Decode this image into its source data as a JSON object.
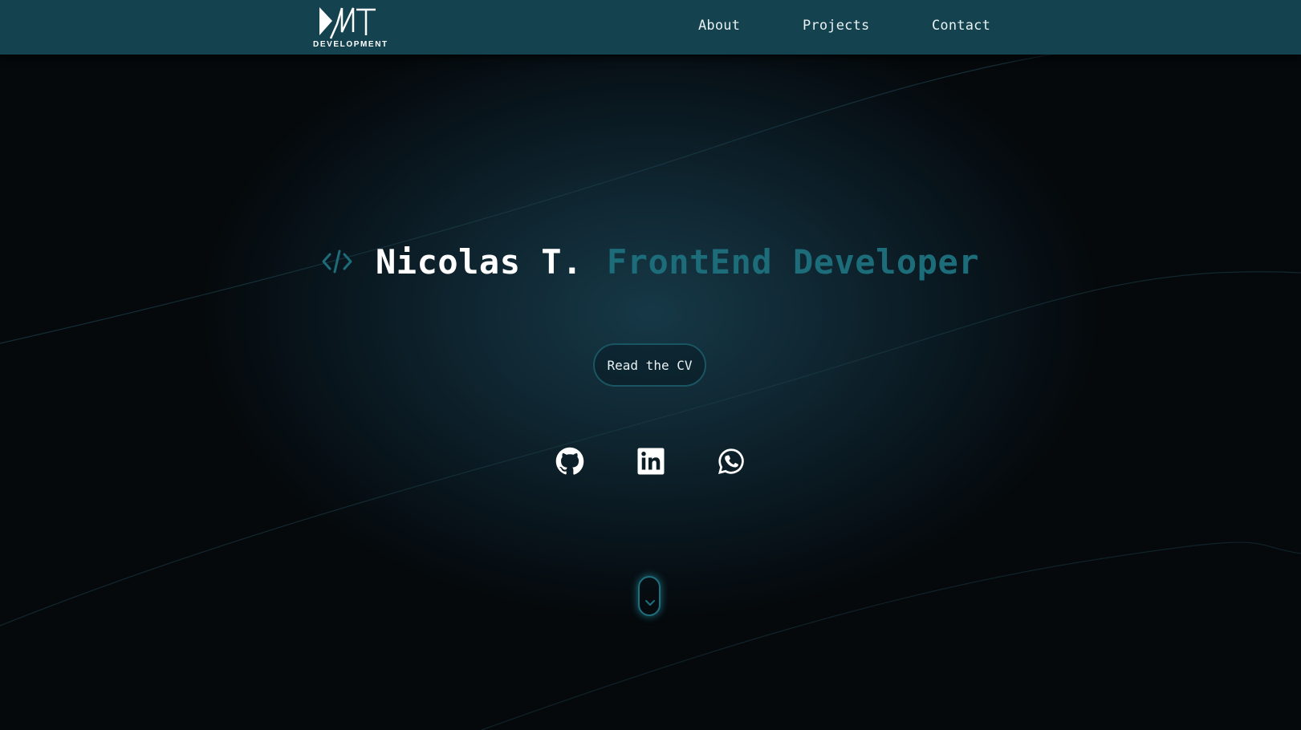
{
  "nav": {
    "logo": {
      "mark": "NT",
      "subtitle": "DEVELOPMENT"
    },
    "links": [
      {
        "label": "About"
      },
      {
        "label": "Projects"
      },
      {
        "label": "Contact"
      }
    ]
  },
  "hero": {
    "icon": "code-brackets-icon",
    "name": "Nicolas T.",
    "role": "FrontEnd Developer",
    "cv_button": "Read the CV"
  },
  "social": [
    {
      "icon": "github-icon"
    },
    {
      "icon": "linkedin-icon"
    },
    {
      "icon": "whatsapp-icon"
    }
  ],
  "scroll": {
    "icon": "chevron-down-icon"
  },
  "colors": {
    "navbar": "#14424f",
    "accent": "#1d6c7a",
    "background": "#05080b",
    "text": "#ffffff"
  }
}
